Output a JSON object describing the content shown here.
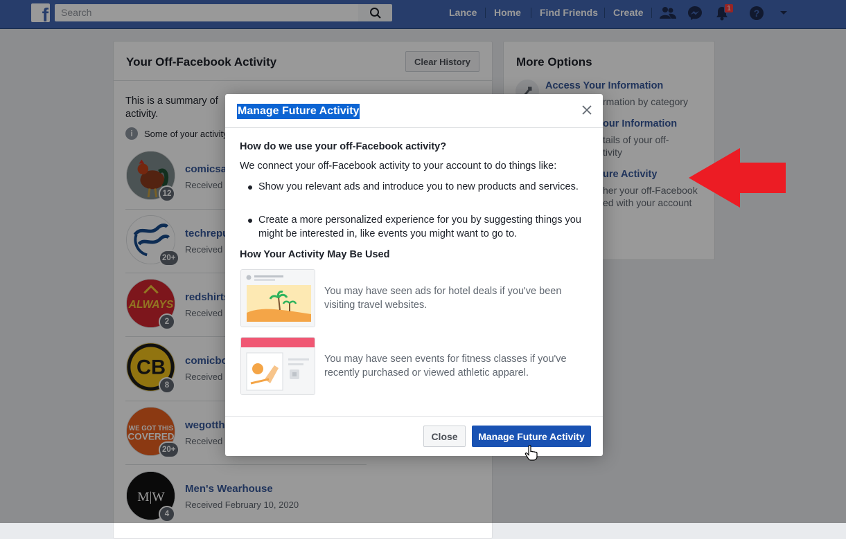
{
  "topbar": {
    "search_placeholder": "Search",
    "nav": [
      "Lance",
      "Home",
      "Find Friends",
      "Create"
    ],
    "notification_count": "1",
    "brand_color": "#4267b2"
  },
  "left_panel": {
    "title": "Your Off-Facebook Activity",
    "clear_history": "Clear History",
    "summary": "This is a summary of activity.",
    "info_note": "Some of your activity"
  },
  "activity": [
    {
      "name": "comicsa",
      "sub": "Received F",
      "count": "12"
    },
    {
      "name": "techrepu",
      "sub": "Received F",
      "count": "20+"
    },
    {
      "name": "redshirts",
      "sub": "Received F",
      "count": "2"
    },
    {
      "name": "comicbo",
      "sub": "Received F",
      "count": "8"
    },
    {
      "name": "wegotth",
      "sub": "Received F",
      "count": "20+"
    },
    {
      "name": "Men's Wearhouse",
      "sub": "Received February 10, 2020",
      "count": "4"
    }
  ],
  "right_panel": {
    "title": "More Options",
    "options": [
      {
        "title": "Access Your Information",
        "desc": "rmation by category"
      },
      {
        "title": "our Information",
        "desc": "tails of your off-\ntivity"
      },
      {
        "title": "ure Activity",
        "desc": "her your off-Facebook\ned with your account"
      }
    ]
  },
  "modal": {
    "title": "Manage Future Activity",
    "question": "How do we use your off-Facebook activity?",
    "intro": "We connect your off-Facebook activity to your account to do things like:",
    "bullets": [
      "Show you relevant ads and introduce you to new products and services.",
      "Create a more personalized experience for you by suggesting things you might be interested in, like events you might want to go to."
    ],
    "subtitle": "How Your Activity May Be Used",
    "examples": [
      "You may have seen ads for hotel deals if you've been visiting travel websites.",
      "You may have seen events for fitness classes if you've recently purchased or viewed athletic apparel."
    ],
    "close_label": "Close",
    "manage_label": "Manage Future Activity"
  },
  "colors": {
    "link": "#365899",
    "primary_button": "#1952b3",
    "arrow": "#e8202a"
  }
}
